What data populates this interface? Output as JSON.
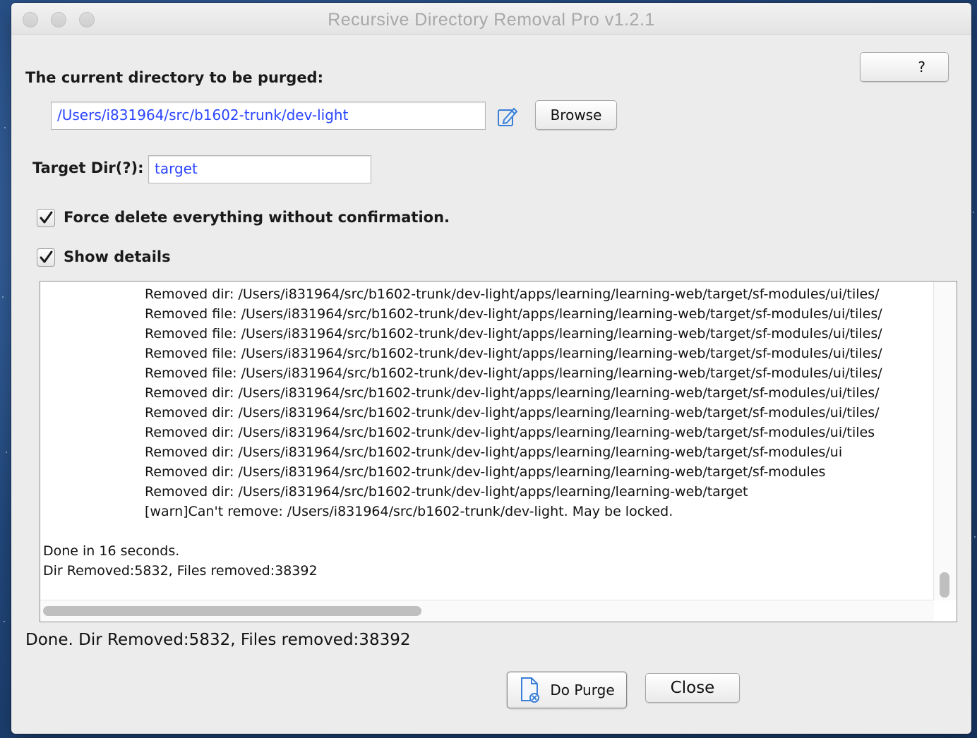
{
  "window": {
    "title": "Recursive Directory Removal Pro v1.2.1"
  },
  "header": {
    "help_label": "?"
  },
  "directory": {
    "label": "The current directory to be purged:",
    "value": "/Users/i831964/src/b1602-trunk/dev-light",
    "browse_label": "Browse"
  },
  "target": {
    "label": "Target Dir(?):",
    "value": "target"
  },
  "options": {
    "force_label": "Force delete everything without confirmation.",
    "force_checked": true,
    "details_label": "Show details",
    "details_checked": true
  },
  "log": {
    "lines": [
      "Removed dir: /Users/i831964/src/b1602-trunk/dev-light/apps/learning/learning-web/target/sf-modules/ui/tiles/",
      "Removed file: /Users/i831964/src/b1602-trunk/dev-light/apps/learning/learning-web/target/sf-modules/ui/tiles/",
      "Removed file: /Users/i831964/src/b1602-trunk/dev-light/apps/learning/learning-web/target/sf-modules/ui/tiles/",
      "Removed file: /Users/i831964/src/b1602-trunk/dev-light/apps/learning/learning-web/target/sf-modules/ui/tiles/",
      "Removed file: /Users/i831964/src/b1602-trunk/dev-light/apps/learning/learning-web/target/sf-modules/ui/tiles/",
      "Removed dir: /Users/i831964/src/b1602-trunk/dev-light/apps/learning/learning-web/target/sf-modules/ui/tiles/",
      "Removed dir: /Users/i831964/src/b1602-trunk/dev-light/apps/learning/learning-web/target/sf-modules/ui/tiles/",
      "Removed dir: /Users/i831964/src/b1602-trunk/dev-light/apps/learning/learning-web/target/sf-modules/ui/tiles",
      "Removed dir: /Users/i831964/src/b1602-trunk/dev-light/apps/learning/learning-web/target/sf-modules/ui",
      "Removed dir: /Users/i831964/src/b1602-trunk/dev-light/apps/learning/learning-web/target/sf-modules",
      "Removed dir: /Users/i831964/src/b1602-trunk/dev-light/apps/learning/learning-web/target",
      "[warn]Can't remove: /Users/i831964/src/b1602-trunk/dev-light. May be locked."
    ],
    "summary_done": "Done in 16 seconds.",
    "summary_counts": "Dir Removed:5832, Files removed:38392"
  },
  "status": {
    "text": "Done. Dir Removed:5832, Files removed:38392"
  },
  "actions": {
    "purge_label": "Do Purge",
    "close_label": "Close"
  }
}
